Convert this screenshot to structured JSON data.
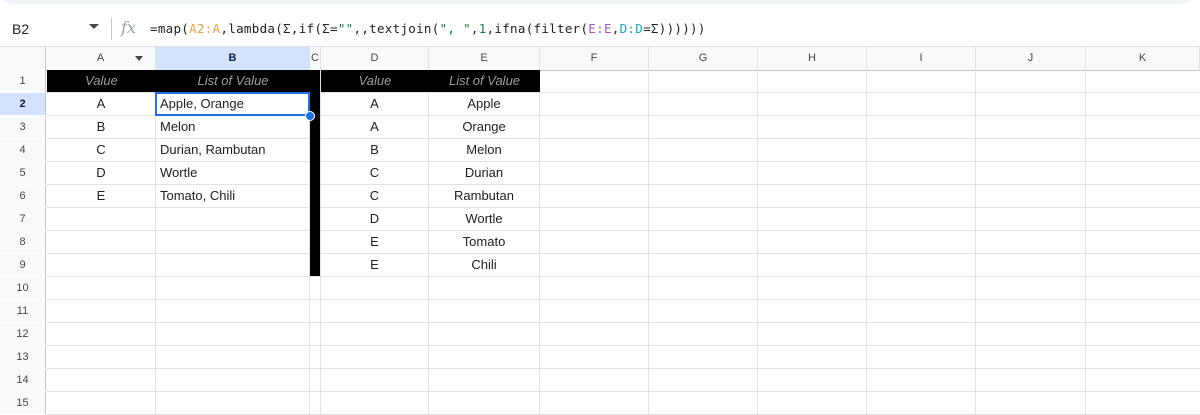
{
  "formula_bar": {
    "name_box": "B2",
    "fx_label": "fx",
    "formula": {
      "p1": "=map(",
      "ref_a": "A2:A",
      "p2": ",lambda(Σ,if(Σ=",
      "s1": "\"\"",
      "p3": ",,textjoin(",
      "s2": "\", \"",
      "p4": ",",
      "n1": "1",
      "p5": ",ifna(filter(",
      "ref_e": "E:E",
      "p6": ",",
      "ref_d": "D:D",
      "p7": "=Σ))))))"
    }
  },
  "columns": [
    "A",
    "B",
    "C",
    "D",
    "E",
    "F",
    "G",
    "H",
    "I",
    "J",
    "K"
  ],
  "rows": [
    "1",
    "2",
    "3",
    "4",
    "5",
    "6",
    "7",
    "8",
    "9",
    "10",
    "11",
    "12",
    "13",
    "14",
    "15"
  ],
  "table1": {
    "headers": [
      "Value",
      "List of Value"
    ],
    "rows": [
      [
        "A",
        "Apple, Orange"
      ],
      [
        "B",
        "Melon"
      ],
      [
        "C",
        "Durian, Rambutan"
      ],
      [
        "D",
        "Wortle"
      ],
      [
        "E",
        "Tomato, Chili"
      ]
    ]
  },
  "table2": {
    "headers": [
      "Value",
      "List of Value"
    ],
    "rows": [
      [
        "A",
        "Apple"
      ],
      [
        "A",
        "Orange"
      ],
      [
        "B",
        "Melon"
      ],
      [
        "C",
        "Durian"
      ],
      [
        "C",
        "Rambutan"
      ],
      [
        "D",
        "Wortle"
      ],
      [
        "E",
        "Tomato"
      ],
      [
        "E",
        "Chili"
      ]
    ]
  },
  "colors": {
    "selection": "#1a73e8",
    "header_fill": "#000000",
    "header_text": "#9e9e9e"
  }
}
